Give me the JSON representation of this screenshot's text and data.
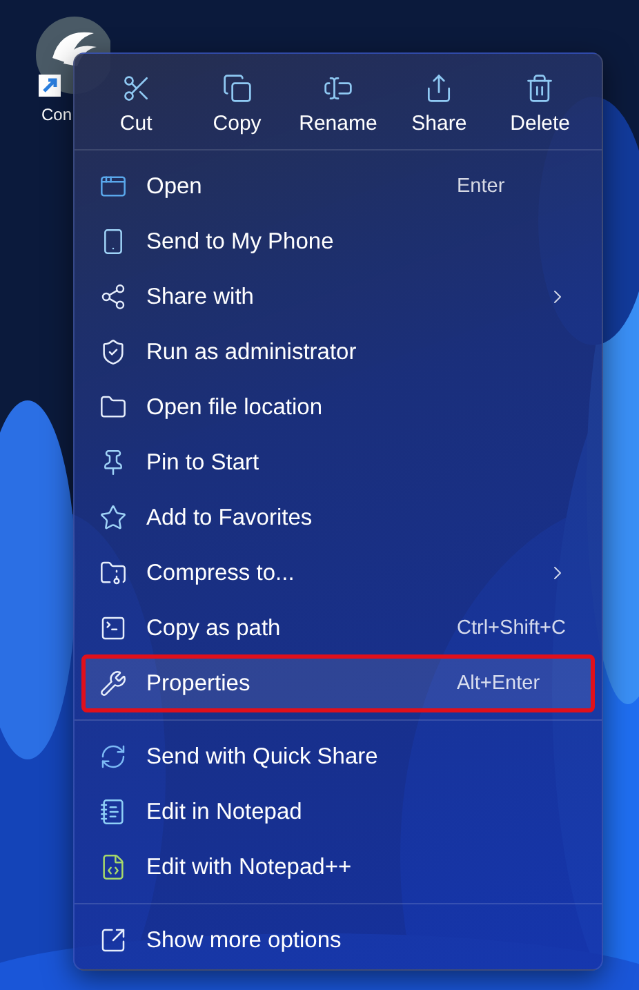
{
  "desktop_icon": {
    "label": "Con"
  },
  "toolbar": [
    {
      "label": "Cut"
    },
    {
      "label": "Copy"
    },
    {
      "label": "Rename"
    },
    {
      "label": "Share"
    },
    {
      "label": "Delete"
    }
  ],
  "sections": [
    {
      "items": [
        {
          "label": "Open",
          "shortcut": "Enter",
          "submenu": false,
          "outlined": false
        },
        {
          "label": "Send to My Phone",
          "submenu": false,
          "outlined": false
        },
        {
          "label": "Share with",
          "submenu": true,
          "outlined": false
        },
        {
          "label": "Run as administrator",
          "submenu": false,
          "outlined": false
        },
        {
          "label": "Open file location",
          "submenu": false,
          "outlined": false
        },
        {
          "label": "Pin to Start",
          "submenu": false,
          "outlined": false
        },
        {
          "label": "Add to Favorites",
          "submenu": false,
          "outlined": false
        },
        {
          "label": "Compress to...",
          "submenu": true,
          "outlined": false
        },
        {
          "label": "Copy as path",
          "shortcut": "Ctrl+Shift+C",
          "submenu": false,
          "outlined": false
        },
        {
          "label": "Properties",
          "shortcut": "Alt+Enter",
          "submenu": false,
          "outlined": true
        }
      ]
    },
    {
      "items": [
        {
          "label": "Send with Quick Share",
          "submenu": false,
          "outlined": false
        },
        {
          "label": "Edit in Notepad",
          "submenu": false,
          "outlined": false
        },
        {
          "label": "Edit with Notepad++",
          "submenu": false,
          "outlined": false
        }
      ]
    },
    {
      "items": [
        {
          "label": "Show more options",
          "submenu": false,
          "outlined": false
        }
      ]
    }
  ]
}
